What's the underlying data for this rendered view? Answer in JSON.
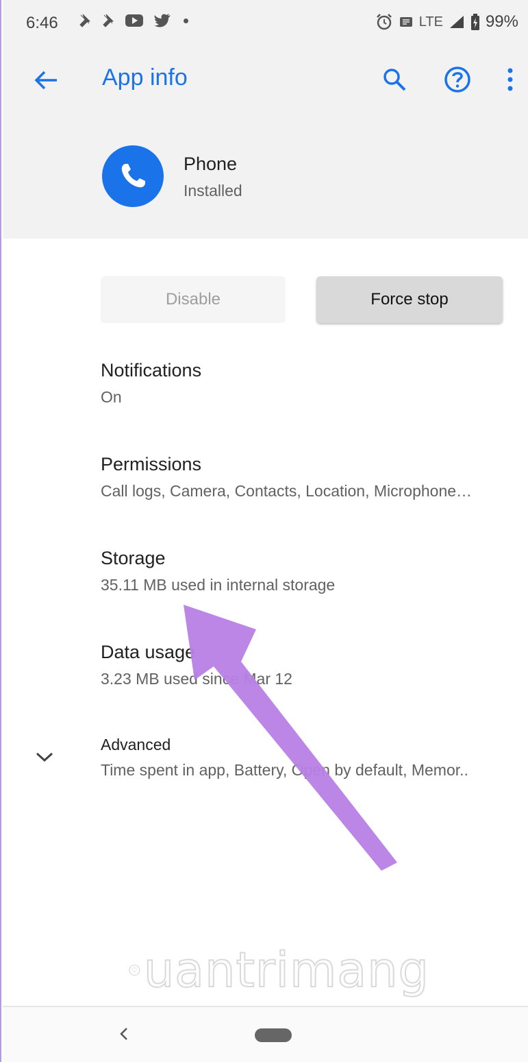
{
  "status_bar": {
    "time": "6:46",
    "network": "LTE",
    "battery": "99%",
    "notification_icons": [
      "pin-icon",
      "pin-icon",
      "youtube-icon",
      "twitter-icon",
      "dot-icon"
    ],
    "right_icons": [
      "alarm-icon",
      "sim-icon",
      "signal-icon",
      "battery-icon"
    ]
  },
  "header": {
    "title": "App info",
    "back_icon": "arrow-left-icon",
    "action_icons": [
      "search-icon",
      "help-icon",
      "more-vert-icon"
    ],
    "accent_color": "#1a73e8"
  },
  "app": {
    "name": "Phone",
    "status": "Installed",
    "icon": "phone-icon",
    "icon_color": "#1a73e8"
  },
  "buttons": {
    "disable": "Disable",
    "force_stop": "Force stop"
  },
  "items": [
    {
      "title": "Notifications",
      "subtitle": "On"
    },
    {
      "title": "Permissions",
      "subtitle": "Call logs, Camera, Contacts, Location, Microphone…"
    },
    {
      "title": "Storage",
      "subtitle": "35.11 MB used in internal storage"
    },
    {
      "title": "Data usage",
      "subtitle": "3.23 MB used since Mar 12"
    }
  ],
  "advanced": {
    "title": "Advanced",
    "subtitle": "Time spent in app, Battery, Open by default, Memor..",
    "icon": "chevron-down-icon"
  },
  "watermark": {
    "text": "uantrimang"
  },
  "annotation": {
    "arrow_color": "#b77fe4"
  }
}
